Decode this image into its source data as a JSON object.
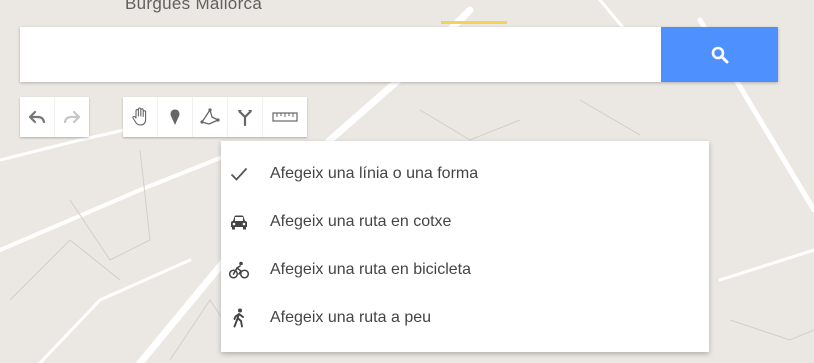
{
  "map": {
    "place_label": "Burgues Mallorca"
  },
  "search": {
    "value": "",
    "placeholder": "",
    "button_icon": "search-icon"
  },
  "toolbar": {
    "groups": [
      [
        "undo-icon",
        "redo-icon"
      ],
      [
        "hand-icon",
        "marker-icon",
        "draw-line-icon",
        "directions-icon",
        "ruler-icon"
      ]
    ]
  },
  "menu": {
    "items": [
      {
        "label": "Afegeix una línia o una forma",
        "icon": "check-icon",
        "checked": true
      },
      {
        "label": "Afegeix una ruta en cotxe",
        "icon": "car-icon"
      },
      {
        "label": "Afegeix una ruta en bicicleta",
        "icon": "bicycle-icon"
      },
      {
        "label": "Afegeix una ruta a peu",
        "icon": "walking-icon"
      }
    ]
  },
  "colors": {
    "accent": "#4d90fe",
    "map_background": "#ebe8e3",
    "road": "#ffffff",
    "highlight_road": "#f2d25a"
  }
}
